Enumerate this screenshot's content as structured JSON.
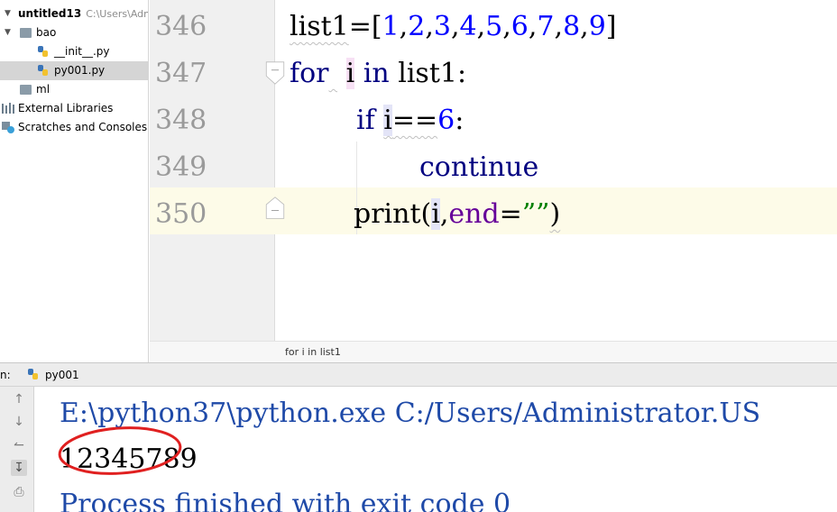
{
  "project_tree": {
    "root": {
      "name": "untitled13",
      "path_hint": "C:\\Users\\Adn"
    },
    "items": [
      {
        "label": "bao",
        "kind": "folder"
      },
      {
        "label": "__init__.py",
        "kind": "python-file"
      },
      {
        "label": "py001.py",
        "kind": "python-file"
      },
      {
        "label": "ml",
        "kind": "folder"
      },
      {
        "label": "External Libraries",
        "kind": "libraries"
      },
      {
        "label": "Scratches and Consoles",
        "kind": "scratches"
      }
    ]
  },
  "editor": {
    "line_numbers": [
      "346",
      "347",
      "348",
      "349",
      "350"
    ],
    "code": {
      "l346": {
        "var": "list1",
        "eq": "=[",
        "n1": "1",
        "n2": "2",
        "n3": "3",
        "n4": "4",
        "n5": "5",
        "n6": "6",
        "n7": "7",
        "n8": "8",
        "n9": "9",
        "comma": ",",
        "close": "]"
      },
      "l347": {
        "kw_for": "for",
        "var_i": "i",
        "kw_in": "in",
        "rest": "list1:"
      },
      "l348": {
        "kw_if": "if",
        "var_i": "i",
        "op": "==",
        "num": "6",
        "colon": ":"
      },
      "l349": {
        "kw": "continue"
      },
      "l350": {
        "fn": "print(",
        "var_i": "i",
        "comma": ",",
        "param": "end",
        "eq": "=",
        "str": "””",
        "close": ")"
      }
    },
    "current_line": "350"
  },
  "breadcrumb": "for i in list1",
  "run_window": {
    "label": "n:",
    "tab_label": "py001",
    "console": {
      "command": "E:\\python37\\python.exe C:/Users/Administrator.US",
      "output": "12345789",
      "exit": "Process finished with exit code 0"
    }
  },
  "colors": {
    "keyword": "#000080",
    "number": "#0000ff",
    "param": "#660099",
    "string": "#008000",
    "console_system": "#1f4aa8",
    "annotation": "#e02020"
  },
  "icons": [
    "collapse-arrow-icon",
    "folder-icon",
    "python-file-icon",
    "library-icon",
    "scratches-icon",
    "fold-icon",
    "rerun-up-icon",
    "rerun-down-icon",
    "soft-wrap-icon",
    "scroll-to-end-icon",
    "print-icon"
  ]
}
